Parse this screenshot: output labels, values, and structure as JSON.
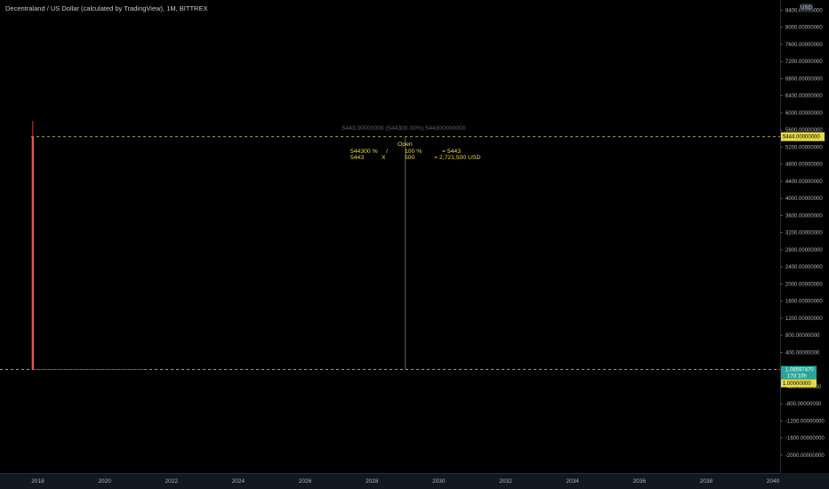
{
  "header": {
    "title": "Decentraland / US Dollar (calculated by TradingView), 1M, BITTREX",
    "currency_badge": "USD"
  },
  "chart_data": {
    "type": "bar",
    "ylim": [
      -2200,
      8400
    ],
    "y_ticks": [
      8400,
      8000,
      7600,
      7200,
      6800,
      6400,
      6000,
      5600,
      5200,
      4800,
      4400,
      4000,
      3600,
      3200,
      2800,
      2400,
      2000,
      1600,
      1200,
      800,
      400,
      -400,
      -800,
      -1200,
      -1600,
      -2000
    ],
    "y_tick_labels": [
      "8400.00000000",
      "8000.00000000",
      "7600.00000000",
      "7200.00000000",
      "6800.00000000",
      "6400.00000000",
      "6000.00000000",
      "5600.00000000",
      "5200.00000000",
      "4800.00000000",
      "4400.00000000",
      "4000.00000000",
      "3600.00000000",
      "3200.00000000",
      "2800.00000000",
      "2400.00000000",
      "2000.00000000",
      "1600.00000000",
      "1200.00000000",
      "800.00000000",
      "400.00000000",
      "-400.00000000",
      "-800.00000000",
      "-1200.00000000",
      "-1600.00000000",
      "-2000.00000000"
    ],
    "x_ticks": [
      2018,
      2020,
      2022,
      2024,
      2026,
      2028,
      2030,
      2032,
      2034,
      2036,
      2038,
      2040
    ],
    "x_tick_labels": [
      "2018",
      "2020",
      "2022",
      "2024",
      "2026",
      "2028",
      "2030",
      "2032",
      "2034",
      "2036",
      "2038",
      "2040"
    ],
    "xlim": [
      2017.7,
      2040.3
    ],
    "spike": {
      "x": 2017.85,
      "high": 5444,
      "low": 1
    },
    "series_line": {
      "x_start": 2017.85,
      "x_end": 2021.2,
      "value": 1.09
    },
    "levels": {
      "upper": 5444,
      "lower": 1
    },
    "range_line_x": 2029.0,
    "colors": {
      "spike": "#ef5350",
      "level": "#e8d84a",
      "price_badge": "#26a69a"
    }
  },
  "range_info": {
    "header": "5443.00000000 (544300.00%) 544300000000"
  },
  "calc": {
    "open_label": "Open",
    "row1": [
      "544300 %",
      "/",
      "100 %",
      "= 5443"
    ],
    "row2": [
      "5443",
      "X",
      "500",
      "= 2,721,500 USD"
    ]
  },
  "price_labels": {
    "upper": "5444.00000000",
    "current": "1.08597470",
    "countdown": "17d 10h",
    "lower": "1.00000000"
  }
}
